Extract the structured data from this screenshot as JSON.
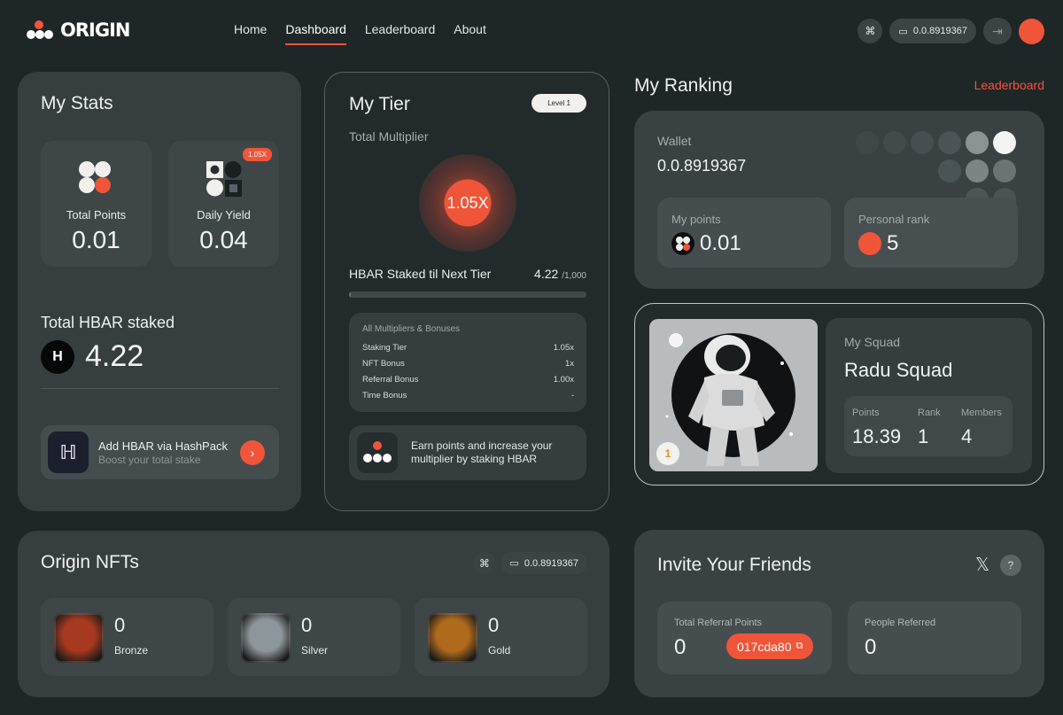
{
  "brand": {
    "name": "ORIGIN"
  },
  "nav": [
    {
      "label": "Home",
      "active": false
    },
    {
      "label": "Dashboard",
      "active": true
    },
    {
      "label": "Leaderboard",
      "active": false
    },
    {
      "label": "About",
      "active": false
    }
  ],
  "header": {
    "wallet": "0.0.8919367"
  },
  "stats": {
    "title": "My Stats",
    "total_points_label": "Total Points",
    "total_points": "0.01",
    "daily_yield_label": "Daily Yield",
    "daily_yield": "0.04",
    "yield_badge": "1.05X",
    "hbar_staked_label": "Total HBAR staked",
    "hbar_staked": "4.22",
    "hbar_symbol": "H",
    "hashpack_title": "Add HBAR via HashPack",
    "hashpack_sub": "Boost your total stake"
  },
  "tier": {
    "title": "My Tier",
    "level": "Level 1",
    "multiplier_label": "Total Multiplier",
    "multiplier": "1.05X",
    "next_label": "HBAR Staked til Next Tier",
    "next_value": "4.22",
    "next_max": "/1,000",
    "progress": 0.0042,
    "list_title": "All Multipliers & Bonuses",
    "rows": [
      {
        "label": "Staking Tier",
        "value": "1.05x"
      },
      {
        "label": "NFT Bonus",
        "value": "1x"
      },
      {
        "label": "Referral Bonus",
        "value": "1.00x"
      },
      {
        "label": "Time Bonus",
        "value": "-"
      }
    ],
    "earn_text": "Earn points and increase your multiplier by staking HBAR"
  },
  "ranking": {
    "title": "My Ranking",
    "link": "Leaderboard",
    "wallet_label": "Wallet",
    "wallet": "0.0.8919367",
    "points_label": "My points",
    "points": "0.01",
    "rank_label": "Personal rank",
    "rank": "5"
  },
  "squad": {
    "badge": "1",
    "label": "My Squad",
    "name": "Radu Squad",
    "points_label": "Points",
    "points": "18.39",
    "rank_label": "Rank",
    "rank": "1",
    "members_label": "Members",
    "members": "4"
  },
  "nfts": {
    "title": "Origin NFTs",
    "wallet": "0.0.8919367",
    "items": [
      {
        "count": "0",
        "name": "Bronze",
        "color": "#a6391f"
      },
      {
        "count": "0",
        "name": "Silver",
        "color": "#8d969a"
      },
      {
        "count": "0",
        "name": "Gold",
        "color": "#b06a1c"
      }
    ]
  },
  "invite": {
    "title": "Invite Your Friends",
    "ref_points_label": "Total Referral Points",
    "ref_points": "0",
    "ref_code": "017cda80",
    "referred_label": "People Referred",
    "referred": "0",
    "x_icon": "𝕏",
    "help_icon": "?"
  },
  "colors": {
    "accent": "#f0553a",
    "bg": "#1f2627",
    "card": "#363e40"
  }
}
